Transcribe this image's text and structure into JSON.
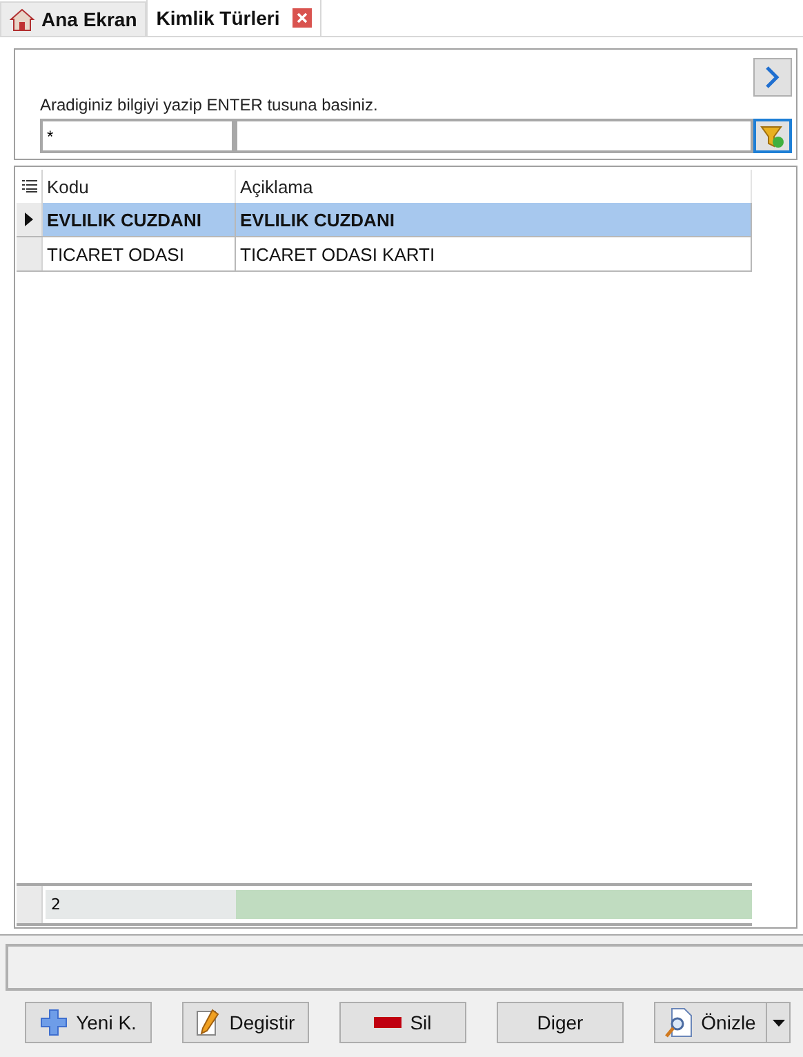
{
  "tabs": [
    {
      "label": "Ana Ekran",
      "selected": false,
      "kind": "home"
    },
    {
      "label": "Kimlik Türleri",
      "selected": true,
      "closable": true
    }
  ],
  "search": {
    "hint": "Aradiginiz bilgiyi yazip ENTER tusuna basiniz.",
    "value": "*"
  },
  "table": {
    "columns": [
      "Kodu",
      "Açiklama"
    ],
    "rows": [
      {
        "cells": [
          "EVLILIK CUZDANI",
          "EVLILIK CUZDANI"
        ],
        "selected": true
      },
      {
        "cells": [
          "TICARET ODASI",
          "TICARET ODASI KARTI"
        ],
        "selected": false
      }
    ],
    "footer_count": "2"
  },
  "buttons": [
    {
      "label": "Yeni K.",
      "kind": "plus"
    },
    {
      "label": "Degistir",
      "kind": "edit"
    },
    {
      "label": "Sil",
      "kind": "minus"
    },
    {
      "label": "Diger",
      "kind": "plain"
    },
    {
      "label": "Önizle",
      "kind": "preview",
      "dropdown": true
    }
  ]
}
